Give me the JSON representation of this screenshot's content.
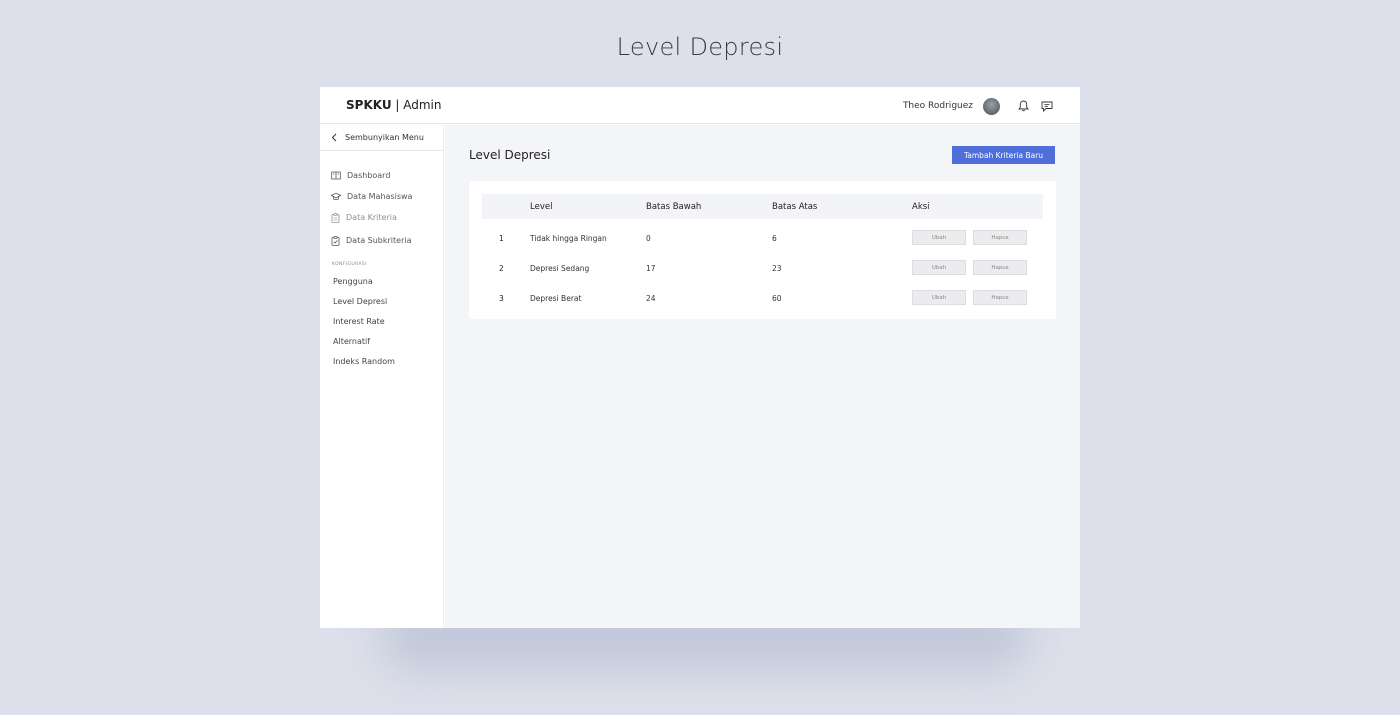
{
  "page_heading": "Level Depresi",
  "header": {
    "brand_bold": "SPKKU",
    "brand_rest": " | Admin",
    "user_name": "Theo Rodriguez"
  },
  "sidebar": {
    "hide_label": "Sembunyikan Menu",
    "menu": [
      {
        "label": "Dashboard",
        "icon": "book-icon"
      },
      {
        "label": "Data Mahasiswa",
        "icon": "graduation-cap-icon"
      },
      {
        "label": "Data Kriteria",
        "icon": "clipboard-icon"
      },
      {
        "label": "Data Subkriteria",
        "icon": "clipboard-check-icon"
      }
    ],
    "section_label": "KONFIGURASI",
    "config": [
      {
        "label": "Pengguna"
      },
      {
        "label": "Level Depresi"
      },
      {
        "label": "Interest Rate"
      },
      {
        "label": "Alternatif"
      },
      {
        "label": "Indeks Random"
      }
    ]
  },
  "main": {
    "title": "Level Depresi",
    "add_button": "Tambah Kriteria Baru",
    "table": {
      "columns": [
        "Level",
        "Batas Bawah",
        "Batas Atas",
        "Aksi"
      ],
      "rows": [
        {
          "no": "1",
          "level": "Tidak hingga Ringan",
          "bawah": "0",
          "atas": "6"
        },
        {
          "no": "2",
          "level": "Depresi Sedang",
          "bawah": "17",
          "atas": "23"
        },
        {
          "no": "3",
          "level": "Depresi Berat",
          "bawah": "24",
          "atas": "60"
        }
      ],
      "edit_label": "Ubah",
      "delete_label": "Hapus"
    }
  },
  "colors": {
    "accent": "#4e6fd9",
    "background": "#dde0ea"
  }
}
